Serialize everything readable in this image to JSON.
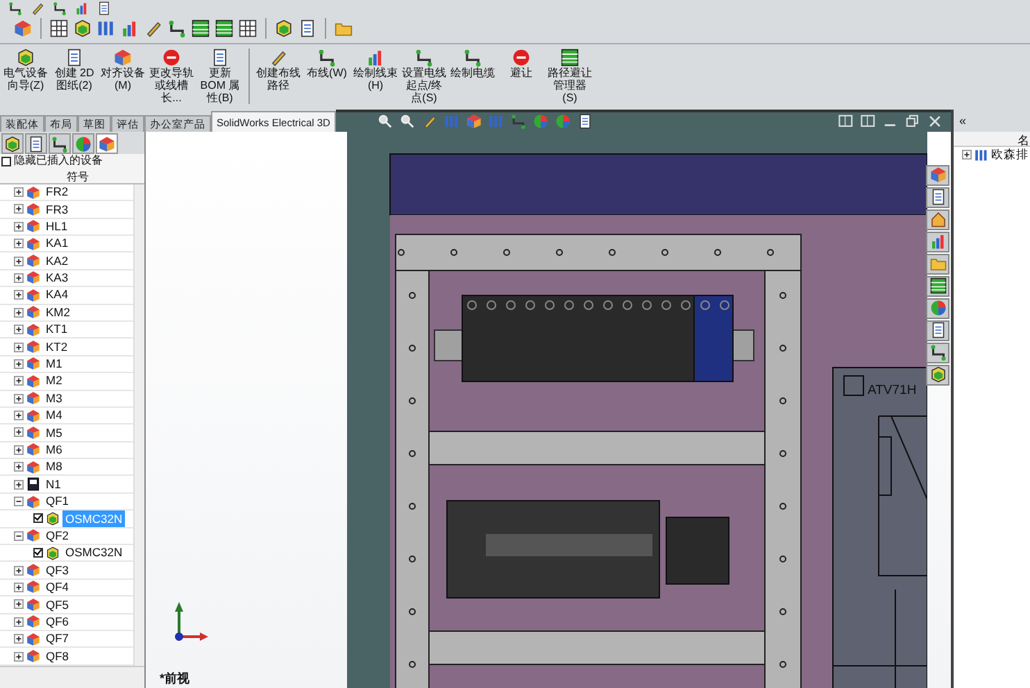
{
  "ribbon": {
    "buttons": [
      {
        "label": "电气设备向导(Z)"
      },
      {
        "label": "创建 2D 图纸(2)"
      },
      {
        "label": "对齐设备(M)"
      },
      {
        "label": "更改导轨或线槽长..."
      },
      {
        "label": "更新 BOM 属性(B)"
      },
      {
        "label": "创建布线路径"
      },
      {
        "label": "布线(W)"
      },
      {
        "label": "绘制线束(H)"
      },
      {
        "label": "设置电线起点/终点(S)"
      },
      {
        "label": "绘制电缆"
      },
      {
        "label": "避让"
      },
      {
        "label": "路径避让管理器(S)"
      }
    ]
  },
  "tabs": [
    {
      "label": "装配体",
      "selected": false
    },
    {
      "label": "布局",
      "selected": false
    },
    {
      "label": "草图",
      "selected": false
    },
    {
      "label": "评估",
      "selected": false
    },
    {
      "label": "办公室产品",
      "selected": false
    },
    {
      "label": "SolidWorks Electrical 3D",
      "selected": true
    }
  ],
  "left_panel": {
    "hide_inserted": {
      "label": "隐藏已插入的设备",
      "checked": false
    },
    "column": "符号",
    "items": [
      {
        "label": "FR2",
        "kind": "device",
        "expanded": false
      },
      {
        "label": "FR3",
        "kind": "device",
        "expanded": false
      },
      {
        "label": "HL1",
        "kind": "device",
        "expanded": false
      },
      {
        "label": "KA1",
        "kind": "device",
        "expanded": false
      },
      {
        "label": "KA2",
        "kind": "device",
        "expanded": false
      },
      {
        "label": "KA3",
        "kind": "device",
        "expanded": false
      },
      {
        "label": "KA4",
        "kind": "device",
        "expanded": false
      },
      {
        "label": "KM2",
        "kind": "device",
        "expanded": false
      },
      {
        "label": "KT1",
        "kind": "device",
        "expanded": false
      },
      {
        "label": "KT2",
        "kind": "device",
        "expanded": false
      },
      {
        "label": "M1",
        "kind": "device",
        "expanded": false
      },
      {
        "label": "M2",
        "kind": "device",
        "expanded": false
      },
      {
        "label": "M3",
        "kind": "device",
        "expanded": false
      },
      {
        "label": "M4",
        "kind": "device",
        "expanded": false
      },
      {
        "label": "M5",
        "kind": "device",
        "expanded": false
      },
      {
        "label": "M6",
        "kind": "device",
        "expanded": false
      },
      {
        "label": "M8",
        "kind": "device",
        "expanded": false
      },
      {
        "label": "N1",
        "kind": "drive",
        "expanded": false
      },
      {
        "label": "QF1",
        "kind": "device",
        "expanded": true,
        "children": [
          {
            "label": "OSMC32N",
            "checked": true,
            "selected": true
          }
        ]
      },
      {
        "label": "QF2",
        "kind": "device",
        "expanded": true,
        "children": [
          {
            "label": "OSMC32N",
            "checked": true,
            "selected": false
          }
        ]
      },
      {
        "label": "QF3",
        "kind": "device",
        "expanded": false
      },
      {
        "label": "QF4",
        "kind": "device",
        "expanded": false
      },
      {
        "label": "QF5",
        "kind": "device",
        "expanded": false
      },
      {
        "label": "QF6",
        "kind": "device",
        "expanded": false
      },
      {
        "label": "QF7",
        "kind": "device",
        "expanded": false
      },
      {
        "label": "QF8",
        "kind": "device",
        "expanded": false
      }
    ]
  },
  "viewport": {
    "view_label": "*前视",
    "device_label": "ATV71H"
  },
  "right_panel": {
    "collapse": "«",
    "column": "名",
    "items": [
      {
        "label": "欧森排",
        "expanded": false
      }
    ]
  }
}
